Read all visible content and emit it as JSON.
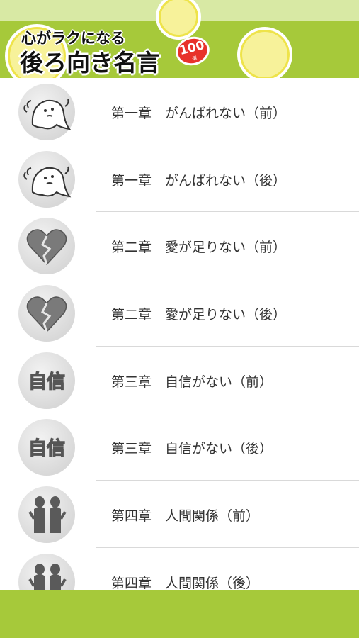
{
  "header": {
    "title_line1": "心がラクになる",
    "title_line2": "後ろ向き名言",
    "badge_number": "100",
    "badge_unit": "選"
  },
  "colors": {
    "header_green": "#a6c93a",
    "header_light": "#d8e9a4",
    "badge_red": "#e8322b",
    "bubble_yellow": "#f7f29a"
  },
  "chapters": [
    {
      "label": "第一章　がんばれない（前）",
      "icon": "ghost-icon"
    },
    {
      "label": "第一章　がんばれない（後）",
      "icon": "ghost-icon"
    },
    {
      "label": "第二章　愛が足りない（前）",
      "icon": "broken-heart-icon"
    },
    {
      "label": "第二章　愛が足りない（後）",
      "icon": "broken-heart-icon"
    },
    {
      "label": "第三章　自信がない（前）",
      "icon": "jishin-text-icon"
    },
    {
      "label": "第三章　自信がない（後）",
      "icon": "jishin-text-icon"
    },
    {
      "label": "第四章　人間関係（前）",
      "icon": "people-silhouette-icon"
    },
    {
      "label": "第四章　人間関係（後）",
      "icon": "people-silhouette-icon"
    }
  ],
  "icon_text": {
    "jishin": "自信"
  }
}
